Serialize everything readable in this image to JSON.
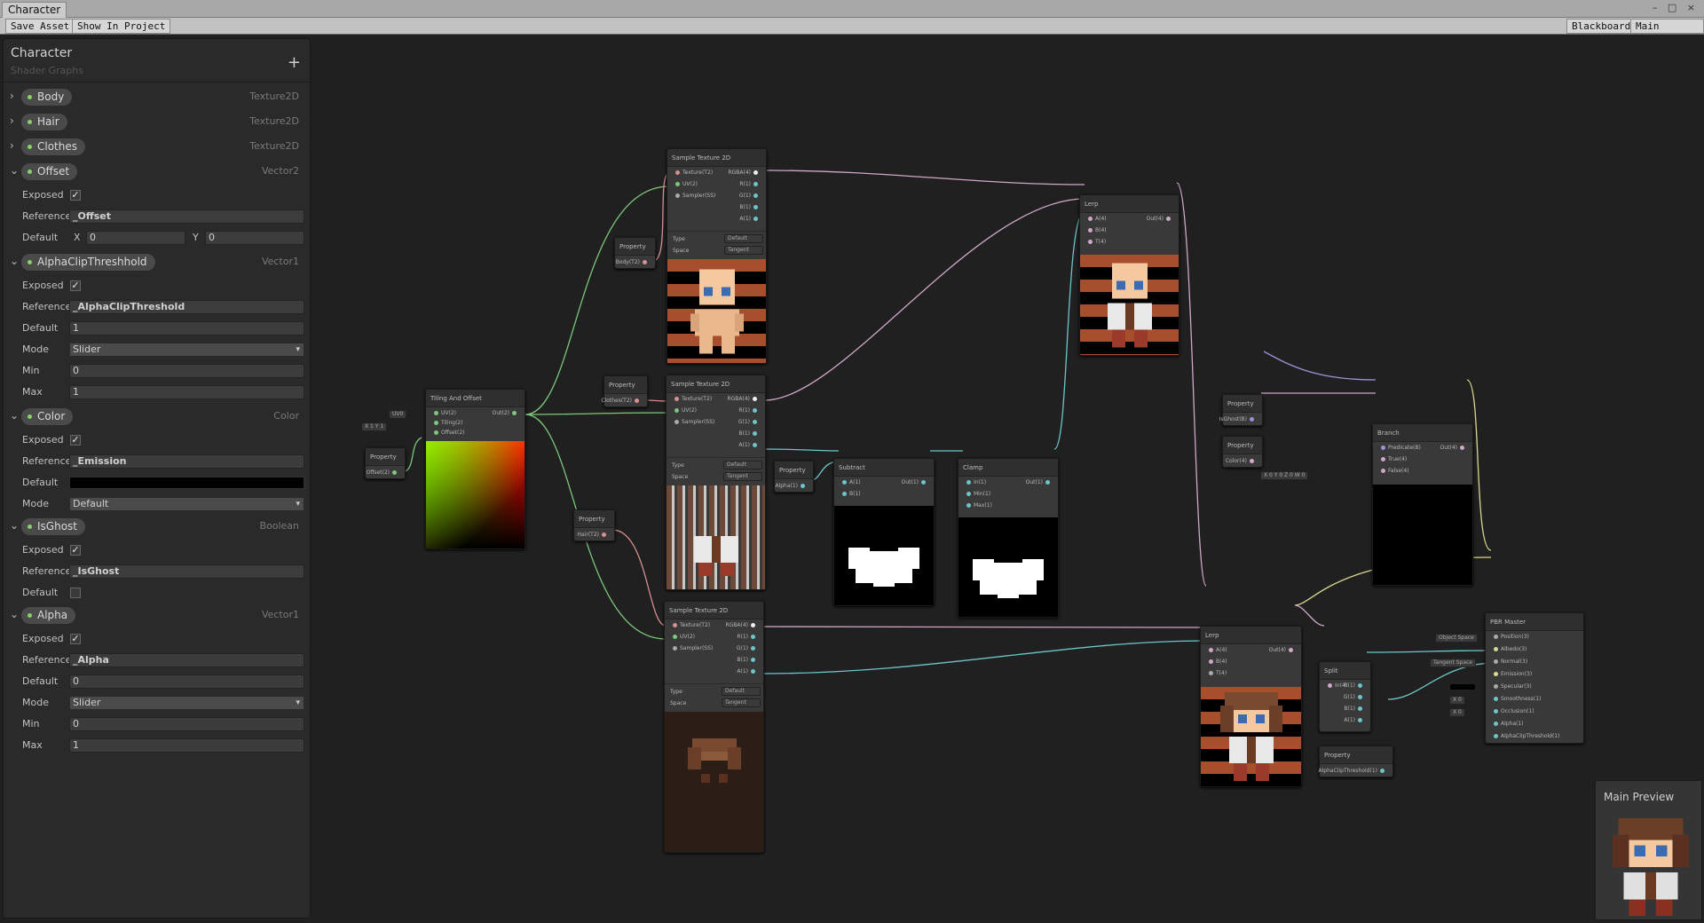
{
  "window": {
    "tab": "Character",
    "controls": "– □ ×"
  },
  "toolbar": {
    "save": "Save Asset",
    "show": "Show In Project",
    "blackboard": "Blackboard",
    "main_preview": "Main Preview"
  },
  "blackboard": {
    "title": "Character",
    "subtitle": "Shader Graphs",
    "add": "+",
    "properties": [
      {
        "name": "Body",
        "type": "Texture2D"
      },
      {
        "name": "Hair",
        "type": "Texture2D"
      },
      {
        "name": "Clothes",
        "type": "Texture2D"
      },
      {
        "name": "Offset",
        "type": "Vector2"
      },
      {
        "name": "AlphaClipThreshhold",
        "type": "Vector1"
      },
      {
        "name": "Color",
        "type": "Color"
      },
      {
        "name": "IsGhost",
        "type": "Boolean"
      },
      {
        "name": "Alpha",
        "type": "Vector1"
      }
    ],
    "labels": {
      "exposed": "Exposed",
      "reference": "Reference",
      "default": "Default",
      "mode": "Mode",
      "min": "Min",
      "max": "Max",
      "x": "X",
      "y": "Y"
    },
    "offset": {
      "reference": "_Offset",
      "x": "0",
      "y": "0"
    },
    "alphaclip": {
      "reference": "_AlphaClipThreshold",
      "default": "1",
      "mode": "Slider",
      "min": "0",
      "max": "1"
    },
    "color": {
      "reference": "_Emission",
      "mode": "Default",
      "default_color": "#000000"
    },
    "isghost": {
      "reference": "_IsGhost"
    },
    "alpha": {
      "reference": "_Alpha",
      "default": "0",
      "mode": "Slider",
      "min": "0",
      "max": "1"
    }
  },
  "nodes": {
    "tiling": {
      "title": "Tiling And Offset",
      "inputs": [
        "UV(2)",
        "Tiling(2)",
        "Offset(2)"
      ],
      "output": "Out(2)",
      "uv_chip": "UV0",
      "tiling_chip": "X 1   Y 1"
    },
    "prop_offset": {
      "title": "Property",
      "port": "Offset(2)"
    },
    "prop_body": {
      "title": "Property",
      "port": "Body(T2)"
    },
    "prop_clothes": {
      "title": "Property",
      "port": "Clothes(T2)"
    },
    "prop_hair": {
      "title": "Property",
      "port": "Hair(T2)"
    },
    "prop_alpha": {
      "title": "Property",
      "port": "Alpha(1)"
    },
    "prop_isghost": {
      "title": "Property",
      "port": "IsGhost(B)"
    },
    "prop_color": {
      "title": "Property",
      "port": "Color(4)"
    },
    "prop_alphaclip": {
      "title": "Property",
      "port": "AlphaClipThreshold(1)"
    },
    "sample": {
      "title": "Sample Texture 2D",
      "inputs": [
        "Texture(T2)",
        "UV(2)",
        "Sampler(SS)"
      ],
      "outputs": [
        "RGBA(4)",
        "R(1)",
        "G(1)",
        "B(1)",
        "A(1)"
      ],
      "type_label": "Type",
      "space_label": "Space",
      "type_val": "Default",
      "space_val": "Tangent"
    },
    "subtract": {
      "title": "Subtract",
      "inputs": [
        "A(1)",
        "B(1)"
      ],
      "output": "Out(1)"
    },
    "clamp": {
      "title": "Clamp",
      "inputs": [
        "In(1)",
        "Min(1)",
        "Max(1)"
      ],
      "output": "Out(1)"
    },
    "lerp": {
      "title": "Lerp",
      "inputs": [
        "A(4)",
        "B(4)",
        "T(4)"
      ],
      "output": "Out(4)"
    },
    "branch": {
      "title": "Branch",
      "inputs": [
        "Predicate(B)",
        "True(4)",
        "False(4)"
      ],
      "output": "Out(4)",
      "false_chip": "X 0   Y 0   Z 0   W 0"
    },
    "split": {
      "title": "Split",
      "input": "In(4)",
      "outputs": [
        "R(1)",
        "G(1)",
        "B(1)",
        "A(1)"
      ]
    },
    "pbr": {
      "title": "PBR Master",
      "inputs": [
        "Position(3)",
        "Albedo(3)",
        "Normal(3)",
        "Emission(3)",
        "Specular(3)",
        "Smoothness(1)",
        "Occlusion(1)",
        "Alpha(1)",
        "AlphaClipThreshold(1)"
      ],
      "chips": [
        "Object Space",
        "Tangent Space",
        "X 0",
        "X 0"
      ]
    }
  },
  "main_preview": {
    "title": "Main Preview"
  }
}
